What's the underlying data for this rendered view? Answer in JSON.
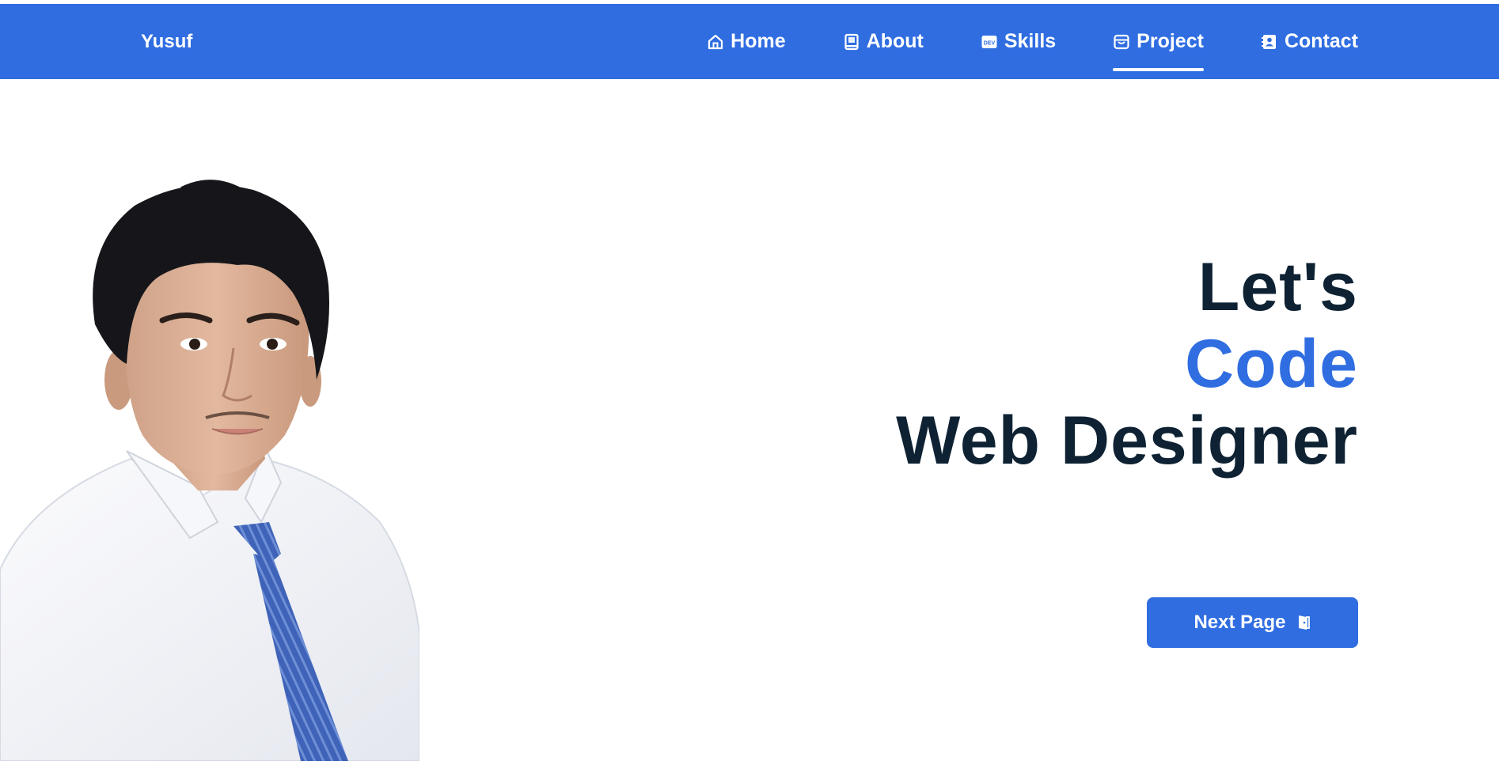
{
  "navbar": {
    "brand": "Yusuf",
    "links": [
      {
        "label": "Home",
        "icon": "home-icon",
        "active": false
      },
      {
        "label": "About",
        "icon": "book-icon",
        "active": false
      },
      {
        "label": "Skills",
        "icon": "dev-icon",
        "active": false
      },
      {
        "label": "Project",
        "icon": "archive-icon",
        "active": true
      }
    ],
    "contact_label": "Contact",
    "contact_icon": "contact-card-icon"
  },
  "hero": {
    "line1": "Let's",
    "line2": "Code",
    "line3": "Web Designer",
    "button_label": "Next Page",
    "button_icon": "door-exit-icon"
  },
  "colors": {
    "brand_blue": "#2f6de1",
    "heading_dark": "#0e2233",
    "background": "#ffffff"
  }
}
